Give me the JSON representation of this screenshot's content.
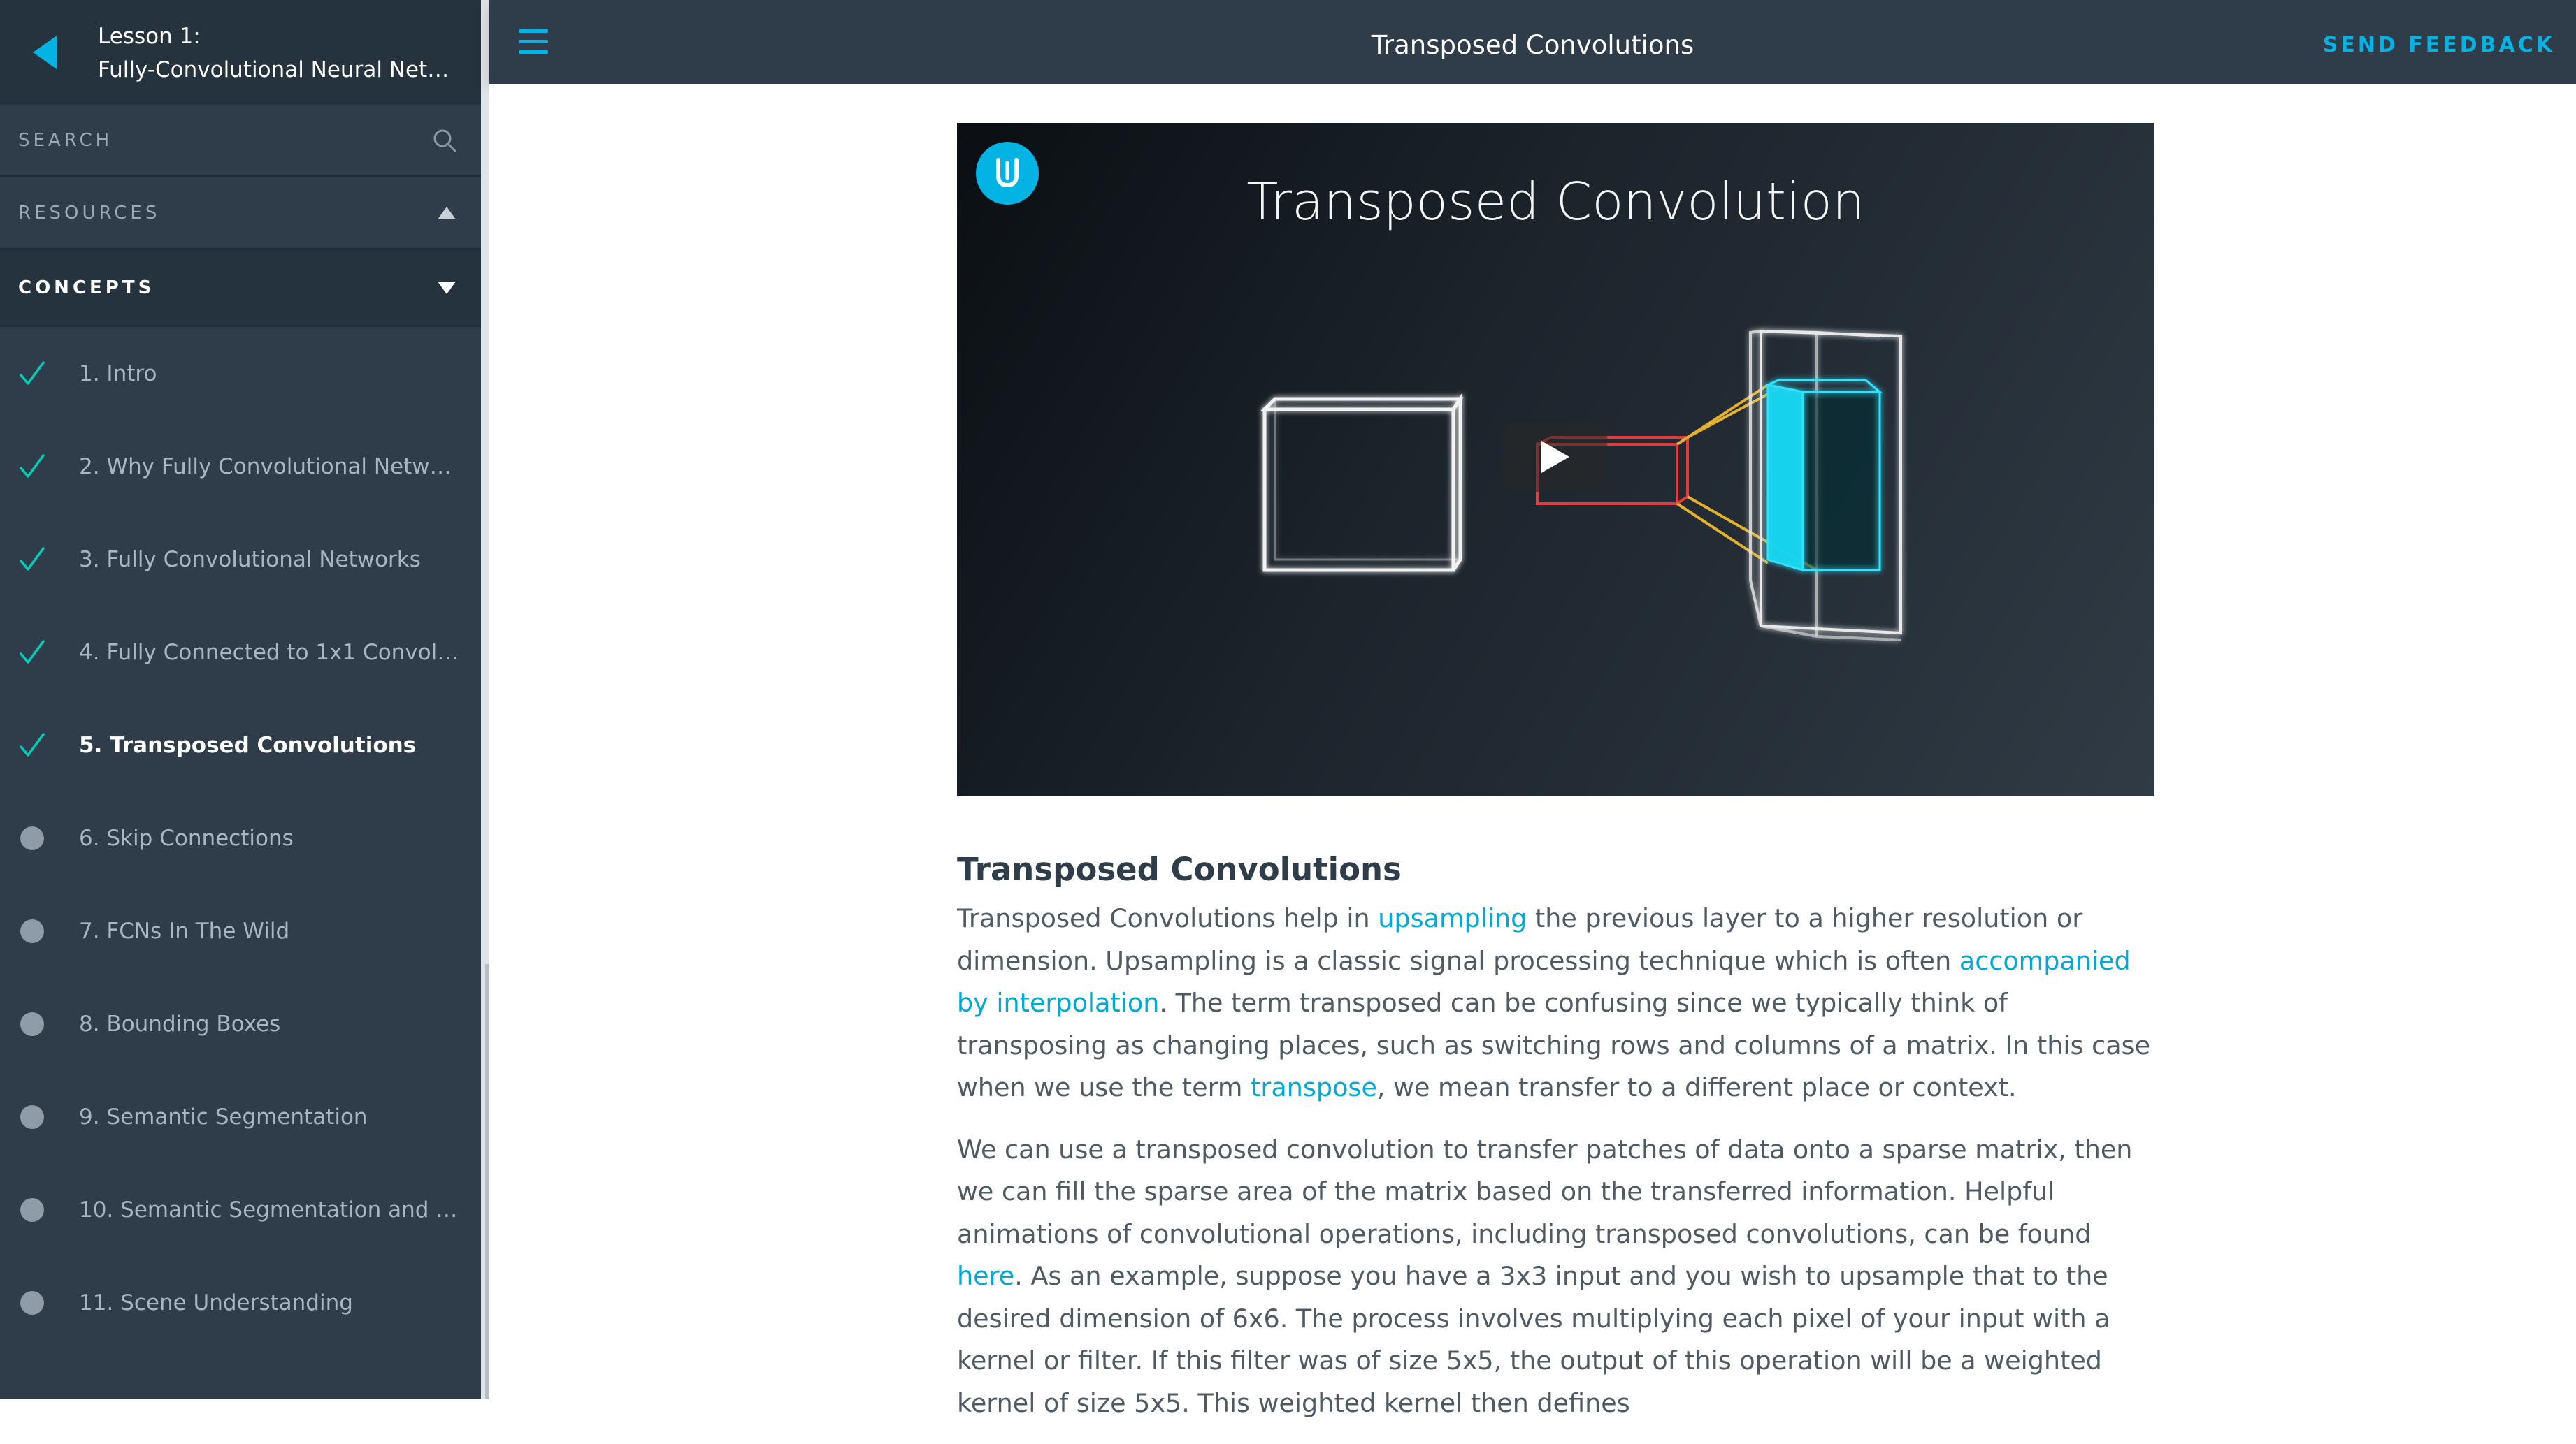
{
  "lesson": {
    "number_label": "Lesson 1:",
    "title": "Fully-Convolutional Neural Netwo..."
  },
  "sidebar": {
    "search_label": "SEARCH",
    "resources_label": "RESOURCES",
    "concepts_label": "CONCEPTS",
    "concepts": [
      {
        "label": "1. Intro",
        "status": "completed"
      },
      {
        "label": "2. Why Fully Convolutional Network...",
        "status": "completed"
      },
      {
        "label": "3. Fully Convolutional Networks",
        "status": "completed"
      },
      {
        "label": "4. Fully Connected to 1x1 Convoluti...",
        "status": "completed"
      },
      {
        "label": "5. Transposed Convolutions",
        "status": "current"
      },
      {
        "label": "6. Skip Connections",
        "status": "not-started"
      },
      {
        "label": "7. FCNs In The Wild",
        "status": "not-started"
      },
      {
        "label": "8. Bounding Boxes",
        "status": "not-started"
      },
      {
        "label": "9. Semantic Segmentation",
        "status": "not-started"
      },
      {
        "label": "10. Semantic Segmentation and FC...",
        "status": "not-started"
      },
      {
        "label": "11. Scene Understanding",
        "status": "not-started"
      }
    ]
  },
  "header": {
    "title": "Transposed Convolutions",
    "feedback_label": "SEND FEEDBACK"
  },
  "video": {
    "title": "Transposed Convolution",
    "logo_letter": "U"
  },
  "article": {
    "heading": "Transposed Convolutions",
    "p1": {
      "t1": "Transposed Convolutions help in ",
      "l1": "upsampling",
      "t2": " the previous layer to a higher resolution or dimension. Upsampling is a classic signal processing technique which is often ",
      "l2": "accompanied by interpolation",
      "t3": ". The term transposed can be confusing since we typically think of transposing as changing places, such as switching rows and columns of a matrix. In this case when we use the term ",
      "l3": "transpose",
      "t4": ", we mean transfer to a different place or context."
    },
    "p2": {
      "t1": "We can use a transposed convolution to transfer patches of data onto a sparse matrix, then we can fill the sparse area of the matrix based on the transferred information. Helpful animations of convolutional operations, including transposed convolutions, can be found ",
      "l1": "here",
      "t2": ". As an example, suppose you have a 3x3 input and you wish to upsample that to the desired dimension of 6x6. The process involves multiplying each pixel of your input with a kernel or filter. If this filter was of size 5x5, the output of this operation will be a weighted kernel of size 5x5. This weighted kernel then defines"
    }
  },
  "colors": {
    "accent": "#02b3e4",
    "sidebar_bg": "#2e3d49",
    "check": "#02ccba"
  }
}
